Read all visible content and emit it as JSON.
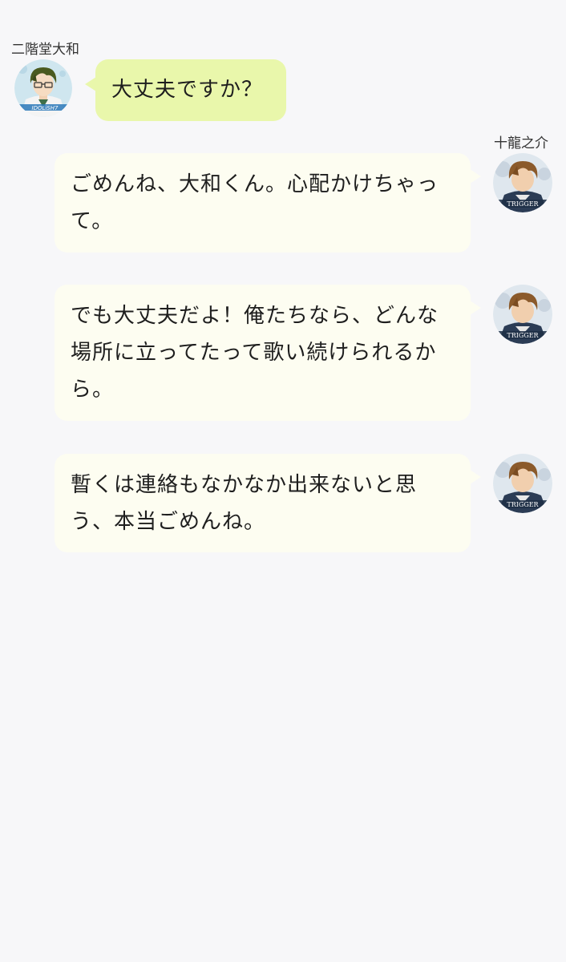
{
  "chat": {
    "incoming": {
      "sender": "二階堂大和",
      "avatar_icon": "yamato-avatar-icon",
      "avatar_badge": "IDOLiSH7",
      "message": "大丈夫ですか？"
    },
    "outgoing": {
      "sender": "十龍之介",
      "avatar_icon": "ryunosuke-avatar-icon",
      "avatar_badge": "TRIGGER",
      "messages": [
        "ごめんね、大和くん。心配かけちゃって。",
        "でも大丈夫だよ！俺たちなら、どんな場所に立ってたって歌い続けられるから。",
        "暫くは連絡もなかなか出来ないと思う、本当ごめんね。"
      ]
    }
  },
  "colors": {
    "background": "#f7f7f9",
    "incoming_bubble": "#e9f7ab",
    "outgoing_bubble": "#fdfdf1"
  }
}
